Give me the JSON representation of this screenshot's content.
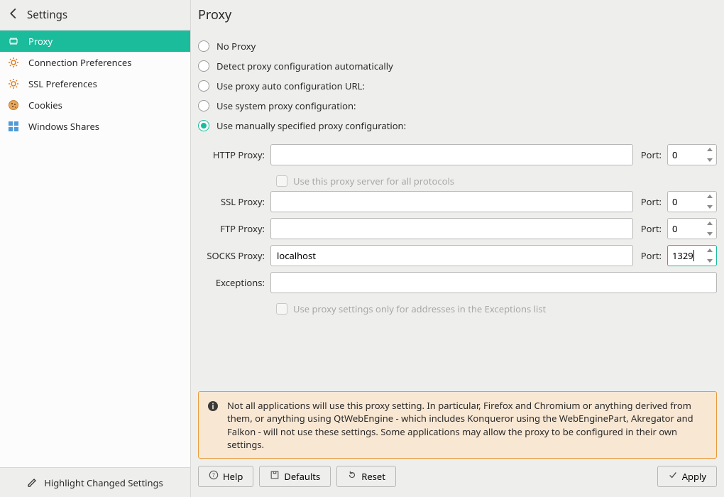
{
  "window_title": "Settings",
  "page_title": "Proxy",
  "sidebar": {
    "items": [
      {
        "label": "Proxy",
        "icon": "chip"
      },
      {
        "label": "Connection Preferences",
        "icon": "gear"
      },
      {
        "label": "SSL Preferences",
        "icon": "gear"
      },
      {
        "label": "Cookies",
        "icon": "cookie"
      },
      {
        "label": "Windows Shares",
        "icon": "shares"
      }
    ],
    "selected": 0,
    "footer_label": "Highlight Changed Settings"
  },
  "proxy_mode": {
    "options": [
      "No Proxy",
      "Detect proxy configuration automatically",
      "Use proxy auto configuration URL:",
      "Use system proxy configuration:",
      "Use manually specified proxy configuration:"
    ],
    "selected": 4
  },
  "fields": {
    "http": {
      "label": "HTTP Proxy:",
      "host": "",
      "port": "0"
    },
    "ssl": {
      "label": "SSL Proxy:",
      "host": "",
      "port": "0"
    },
    "ftp": {
      "label": "FTP Proxy:",
      "host": "",
      "port": "0"
    },
    "socks": {
      "label": "SOCKS Proxy:",
      "host": "localhost",
      "port": "1329"
    },
    "exceptions": {
      "label": "Exceptions:",
      "value": ""
    },
    "port_label": "Port:",
    "all_protocols": "Use this proxy server for all protocols",
    "exceptions_only": "Use proxy settings only for addresses in the Exceptions list"
  },
  "notice": "Not all applications will use this proxy setting. In particular, Firefox and Chromium or anything derived from them, or anything using QtWebEngine - which includes Konqueror using the WebEnginePart, Akregator and Falkon - will not use these settings. Some applications may allow the proxy to be configured in their own settings.",
  "buttons": {
    "help": "Help",
    "defaults": "Defaults",
    "reset": "Reset",
    "apply": "Apply"
  }
}
